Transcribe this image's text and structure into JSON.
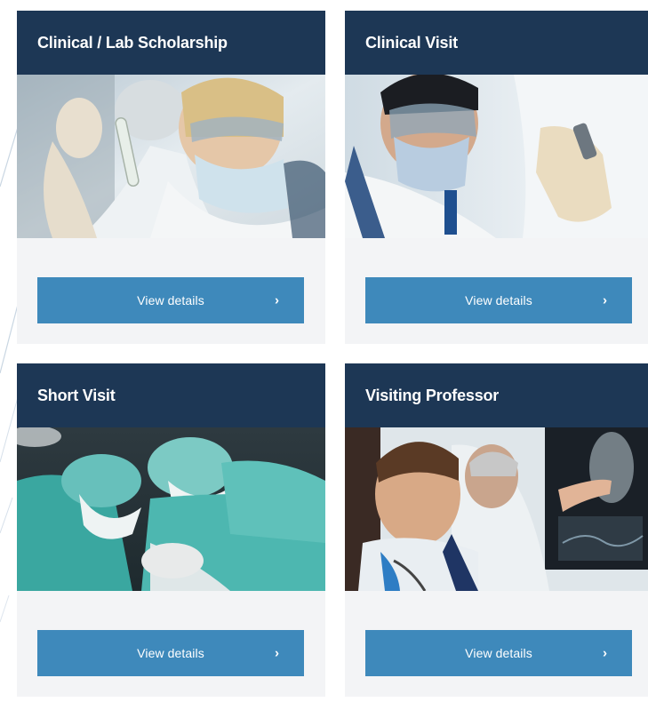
{
  "cards": [
    {
      "title": "Clinical / Lab Scholarship",
      "image": "researcher-examining-test-tube",
      "button_label": "View details",
      "button_icon": "chevron-right-icon"
    },
    {
      "title": "Clinical Visit",
      "image": "scientist-with-pipette",
      "button_label": "View details",
      "button_icon": "chevron-right-icon"
    },
    {
      "title": "Short Visit",
      "image": "surgeons-operating",
      "button_label": "View details",
      "button_icon": "chevron-right-icon"
    },
    {
      "title": "Visiting Professor",
      "image": "doctors-reviewing-xray",
      "button_label": "View details",
      "button_icon": "chevron-right-icon"
    }
  ],
  "colors": {
    "header_bg": "#1d3755",
    "card_bg": "#f3f4f6",
    "button_bg": "#3e89bb",
    "text_light": "#ffffff"
  },
  "icons": {
    "chevron": "›"
  }
}
